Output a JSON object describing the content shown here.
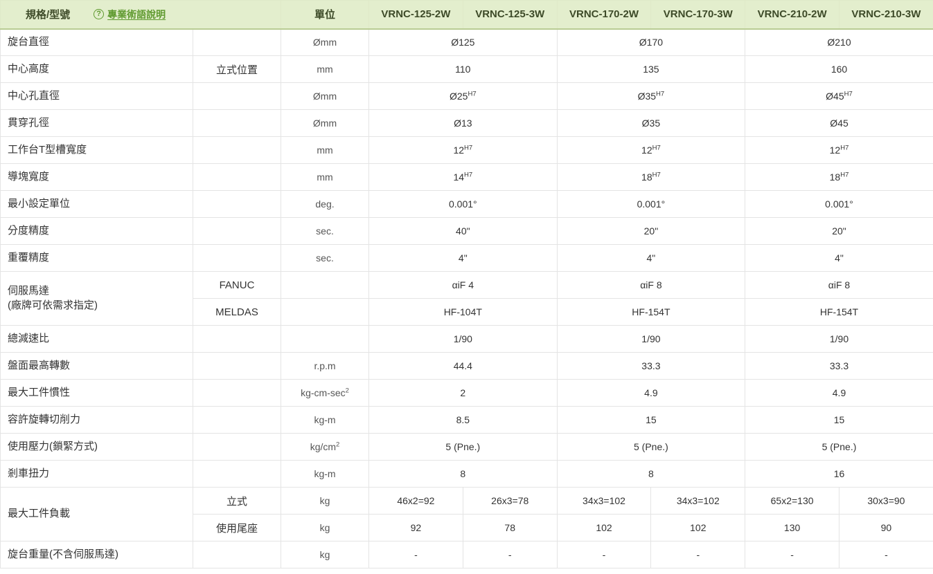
{
  "header": {
    "spec_label": "規格/型號",
    "glossary": {
      "icon": "question-circle-icon",
      "icon_glyph": "?",
      "label": "專業術語說明",
      "color": "#5f9a2f"
    },
    "unit_label": "單位",
    "models": [
      "VRNC-125-2W",
      "VRNC-125-3W",
      "VRNC-170-2W",
      "VRNC-170-3W",
      "VRNC-210-2W",
      "VRNC-210-3W"
    ],
    "background": "#e3eecd"
  },
  "rows": [
    {
      "name": "旋台直徑",
      "sub": "",
      "unit": "Ømm",
      "values": [
        {
          "text": "Ø125",
          "span": 2
        },
        {
          "text": "Ø170",
          "span": 2
        },
        {
          "text": "Ø210",
          "span": 2
        }
      ]
    },
    {
      "name": "中心高度",
      "sub": "立式位置",
      "unit": "mm",
      "values": [
        {
          "text": "110",
          "span": 2
        },
        {
          "text": "135",
          "span": 2
        },
        {
          "text": "160",
          "span": 2
        }
      ]
    },
    {
      "name": "中心孔直徑",
      "sub": "",
      "unit": "Ømm",
      "values": [
        {
          "text": "Ø25",
          "sup": "H7",
          "span": 2
        },
        {
          "text": "Ø35",
          "sup": "H7",
          "span": 2
        },
        {
          "text": "Ø45",
          "sup": "H7",
          "span": 2
        }
      ]
    },
    {
      "name": "貫穿孔徑",
      "sub": "",
      "unit": "Ømm",
      "values": [
        {
          "text": "Ø13",
          "span": 2
        },
        {
          "text": "Ø35",
          "span": 2
        },
        {
          "text": "Ø45",
          "span": 2
        }
      ]
    },
    {
      "name": "工作台T型槽寬度",
      "sub": "",
      "unit": "mm",
      "values": [
        {
          "text": "12",
          "sup": "H7",
          "span": 2
        },
        {
          "text": "12",
          "sup": "H7",
          "span": 2
        },
        {
          "text": "12",
          "sup": "H7",
          "span": 2
        }
      ]
    },
    {
      "name": "導塊寬度",
      "sub": "",
      "unit": "mm",
      "values": [
        {
          "text": "14",
          "sup": "H7",
          "span": 2
        },
        {
          "text": "18",
          "sup": "H7",
          "span": 2
        },
        {
          "text": "18",
          "sup": "H7",
          "span": 2
        }
      ]
    },
    {
      "name": "最小設定單位",
      "sub": "",
      "unit": "deg.",
      "values": [
        {
          "text": "0.001°",
          "span": 2
        },
        {
          "text": "0.001°",
          "span": 2
        },
        {
          "text": "0.001°",
          "span": 2
        }
      ]
    },
    {
      "name": "分度精度",
      "sub": "",
      "unit": "sec.",
      "values": [
        {
          "text": "40\"",
          "span": 2
        },
        {
          "text": "20\"",
          "span": 2
        },
        {
          "text": "20\"",
          "span": 2
        }
      ]
    },
    {
      "name": "重覆精度",
      "sub": "",
      "unit": "sec.",
      "values": [
        {
          "text": "4\"",
          "span": 2
        },
        {
          "text": "4\"",
          "span": 2
        },
        {
          "text": "4\"",
          "span": 2
        }
      ]
    },
    {
      "name": "伺服馬達\n(廠牌可依需求指定)",
      "name_rowspan": 2,
      "sub": "FANUC",
      "unit": "",
      "values": [
        {
          "text": "αiF 4",
          "span": 2
        },
        {
          "text": "αiF 8",
          "span": 2
        },
        {
          "text": "αiF 8",
          "span": 2
        }
      ]
    },
    {
      "name": null,
      "sub": "MELDAS",
      "unit": "",
      "values": [
        {
          "text": "HF-104T",
          "span": 2
        },
        {
          "text": "HF-154T",
          "span": 2
        },
        {
          "text": "HF-154T",
          "span": 2
        }
      ]
    },
    {
      "name": "總減速比",
      "sub": "",
      "unit": "",
      "values": [
        {
          "text": "1/90",
          "span": 2
        },
        {
          "text": "1/90",
          "span": 2
        },
        {
          "text": "1/90",
          "span": 2
        }
      ]
    },
    {
      "name": "盤面最高轉數",
      "sub": "",
      "unit": "r.p.m",
      "values": [
        {
          "text": "44.4",
          "span": 2
        },
        {
          "text": "33.3",
          "span": 2
        },
        {
          "text": "33.3",
          "span": 2
        }
      ]
    },
    {
      "name": "最大工件慣性",
      "sub": "",
      "unit": "kg-cm-sec",
      "unit_sup": "2",
      "values": [
        {
          "text": "2",
          "span": 2
        },
        {
          "text": "4.9",
          "span": 2
        },
        {
          "text": "4.9",
          "span": 2
        }
      ]
    },
    {
      "name": "容許旋轉切削力",
      "sub": "",
      "unit": "kg-m",
      "values": [
        {
          "text": "8.5",
          "span": 2
        },
        {
          "text": "15",
          "span": 2
        },
        {
          "text": "15",
          "span": 2
        }
      ]
    },
    {
      "name": "使用壓力(鎖緊方式)",
      "sub": "",
      "unit": "kg/cm",
      "unit_sup": "2",
      "values": [
        {
          "text": "5 (Pne.)",
          "span": 2
        },
        {
          "text": "5 (Pne.)",
          "span": 2
        },
        {
          "text": "5 (Pne.)",
          "span": 2
        }
      ]
    },
    {
      "name": "剎車扭力",
      "sub": "",
      "unit": "kg-m",
      "values": [
        {
          "text": "8",
          "span": 2
        },
        {
          "text": "8",
          "span": 2
        },
        {
          "text": "16",
          "span": 2
        }
      ]
    },
    {
      "name": "最大工件負載",
      "name_rowspan": 2,
      "sub": "立式",
      "unit": "kg",
      "values": [
        {
          "text": "46x2=92",
          "span": 1
        },
        {
          "text": "26x3=78",
          "span": 1
        },
        {
          "text": "34x3=102",
          "span": 1
        },
        {
          "text": "34x3=102",
          "span": 1
        },
        {
          "text": "65x2=130",
          "span": 1
        },
        {
          "text": "30x3=90",
          "span": 1
        }
      ]
    },
    {
      "name": null,
      "sub": "使用尾座",
      "unit": "kg",
      "values": [
        {
          "text": "92",
          "span": 1
        },
        {
          "text": "78",
          "span": 1
        },
        {
          "text": "102",
          "span": 1
        },
        {
          "text": "102",
          "span": 1
        },
        {
          "text": "130",
          "span": 1
        },
        {
          "text": "90",
          "span": 1
        }
      ]
    },
    {
      "name": "旋台重量(不含伺服馬達)",
      "sub": "",
      "unit": "kg",
      "values": [
        {
          "text": "-",
          "span": 1
        },
        {
          "text": "-",
          "span": 1
        },
        {
          "text": "-",
          "span": 1
        },
        {
          "text": "-",
          "span": 1
        },
        {
          "text": "-",
          "span": 1
        },
        {
          "text": "-",
          "span": 1
        }
      ]
    }
  ]
}
